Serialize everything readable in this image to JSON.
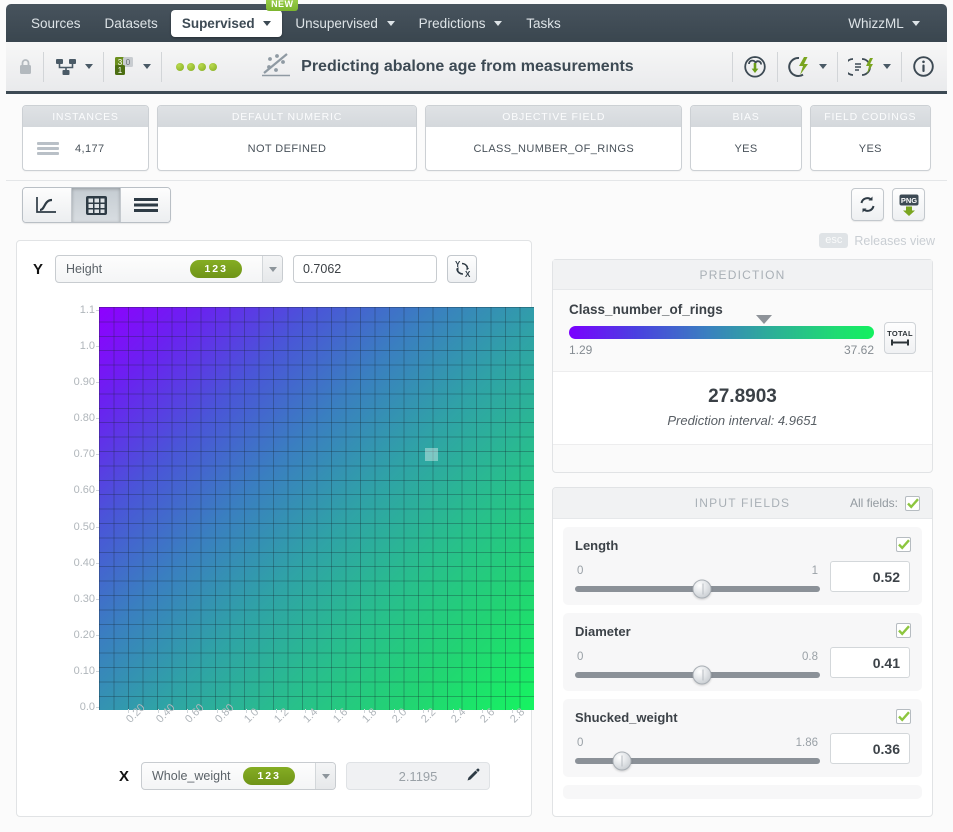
{
  "nav": {
    "items": [
      {
        "label": "Sources",
        "caret": false,
        "active": false
      },
      {
        "label": "Datasets",
        "caret": false,
        "active": false
      },
      {
        "label": "Supervised",
        "caret": true,
        "active": true,
        "badge": "NEW"
      },
      {
        "label": "Unsupervised",
        "caret": true,
        "active": false
      },
      {
        "label": "Predictions",
        "caret": true,
        "active": false
      },
      {
        "label": "Tasks",
        "caret": false,
        "active": false
      }
    ],
    "right": {
      "label": "WhizzML",
      "caret": true
    }
  },
  "resource_bar": {
    "title": "Predicting abalone age from measurements",
    "lock_icon": "lock-icon",
    "tree_icon": "model-tree-icon",
    "fields_icon": "field-types-icon",
    "status_dots": 4,
    "download_icon": "cloud-download-icon",
    "actions_icon": "lightning-actions-icon",
    "script_icon": "script-actions-icon",
    "info_icon": "info-icon"
  },
  "cards": [
    {
      "title": "INSTANCES",
      "value": "4,177",
      "icon": "rows-icon"
    },
    {
      "title": "DEFAULT NUMERIC",
      "value": "NOT DEFINED",
      "icon": ""
    },
    {
      "title": "OBJECTIVE FIELD",
      "value": "CLASS_NUMBER_OF_RINGS",
      "icon": ""
    },
    {
      "title": "BIAS",
      "value": "YES",
      "icon": ""
    },
    {
      "title": "FIELD CODINGS",
      "value": "YES",
      "icon": ""
    }
  ],
  "viewbar": {
    "toggles": [
      {
        "name": "curve-view",
        "active": false
      },
      {
        "name": "grid-view",
        "active": true
      },
      {
        "name": "list-view",
        "active": false
      }
    ],
    "reset_icon": "refresh-icon",
    "png_label": "PNG"
  },
  "esc_hint": {
    "key": "esc",
    "label": "Releases view"
  },
  "chart_panel": {
    "y_letter": "Y",
    "y_field": "Height",
    "y_type_badge": "123",
    "y_value": "0.7062",
    "swap_icon": "swap-axes-icon",
    "x_letter": "X",
    "x_field": "Whole_weight",
    "x_type_badge": "123",
    "x_value": "2.1195",
    "edit_icon": "pencil-icon"
  },
  "chart_data": {
    "type": "heatmap",
    "title": "",
    "xlabel": "Whole_weight",
    "ylabel": "Height",
    "x_ticks": [
      "0.20",
      "0.40",
      "0.60",
      "0.80",
      "1.0",
      "1.2",
      "1.4",
      "1.6",
      "1.8",
      "2.0",
      "2.2",
      "2.4",
      "2.6",
      "2.8"
    ],
    "y_ticks": [
      "0.0",
      "0.10",
      "0.20",
      "0.30",
      "0.40",
      "0.50",
      "0.60",
      "0.70",
      "0.80",
      "0.90",
      "1.0",
      "1.1"
    ],
    "xlim": [
      0.0,
      2.95
    ],
    "ylim": [
      0.0,
      1.15
    ],
    "grid": true,
    "colorscale": [
      "#8f00ff",
      "#4a55d8",
      "#2fa3a6",
      "#16f461"
    ],
    "value_range": [
      1.29,
      37.62
    ],
    "selected_point": {
      "x": 2.1195,
      "y": 0.7062,
      "value": 27.8903
    },
    "legend": ""
  },
  "prediction": {
    "panel_title": "PREDICTION",
    "field_name": "Class_number_of_rings",
    "range_min": "1.29",
    "range_max": "37.62",
    "marker_percent": 64,
    "total_button": "TOTAL",
    "value": "27.8903",
    "interval": "Prediction interval: 4.9651"
  },
  "input_fields": {
    "panel_title": "INPUT FIELDS",
    "all_fields_label": "All fields:",
    "all_fields_checked": true,
    "fields": [
      {
        "name": "Length",
        "min": "0",
        "max": "1",
        "value": "0.52",
        "percent": 52,
        "checked": true
      },
      {
        "name": "Diameter",
        "min": "0",
        "max": "0.8",
        "value": "0.41",
        "percent": 52,
        "checked": true
      },
      {
        "name": "Shucked_weight",
        "min": "0",
        "max": "1.86",
        "value": "0.36",
        "percent": 19,
        "checked": true
      }
    ]
  },
  "colors": {
    "nav_bg": "#3d4a54",
    "accent_green": "#8dc63f",
    "badge_green": "#7aa51f",
    "heatmap_low": "#8f00ff",
    "heatmap_high": "#16f461"
  }
}
